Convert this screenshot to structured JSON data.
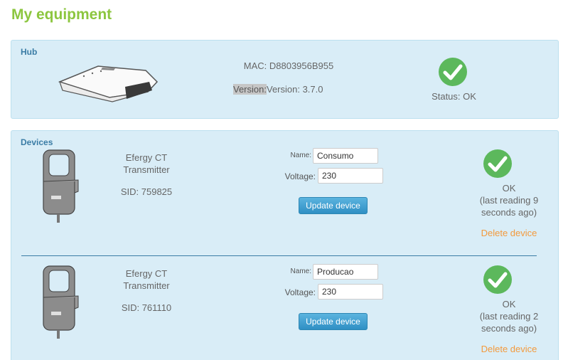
{
  "page": {
    "title": "My equipment"
  },
  "hub": {
    "title": "Hub",
    "mac": "MAC: D8803956B955",
    "version_highlight": "Version:",
    "version_text": "Version: 3.7.0",
    "status": "Status: OK",
    "status_color": "#5cb85c"
  },
  "devices": {
    "title": "Devices",
    "items": [
      {
        "name_line1": "Efergy CT",
        "name_line2": "Transmitter",
        "sid": "SID: 759825",
        "name_label": "Name:",
        "name_value": "Consumo",
        "voltage_label": "Voltage:",
        "voltage_value": "230",
        "update_label": "Update device",
        "status_line1": "OK",
        "status_line2": "(last reading 9",
        "status_line3": "seconds ago)",
        "delete_label": "Delete device"
      },
      {
        "name_line1": "Efergy CT",
        "name_line2": "Transmitter",
        "sid": "SID: 761110",
        "name_label": "Name:",
        "name_value": "Producao",
        "voltage_label": "Voltage:",
        "voltage_value": "230",
        "update_label": "Update device",
        "status_line1": "OK",
        "status_line2": "(last reading 2",
        "status_line3": "seconds ago)",
        "delete_label": "Delete device"
      }
    ]
  },
  "colors": {
    "title_green": "#8cc63f",
    "panel_bg": "#d9edf7",
    "link_orange": "#f39a3d",
    "button_blue": "#2f8fc4"
  }
}
